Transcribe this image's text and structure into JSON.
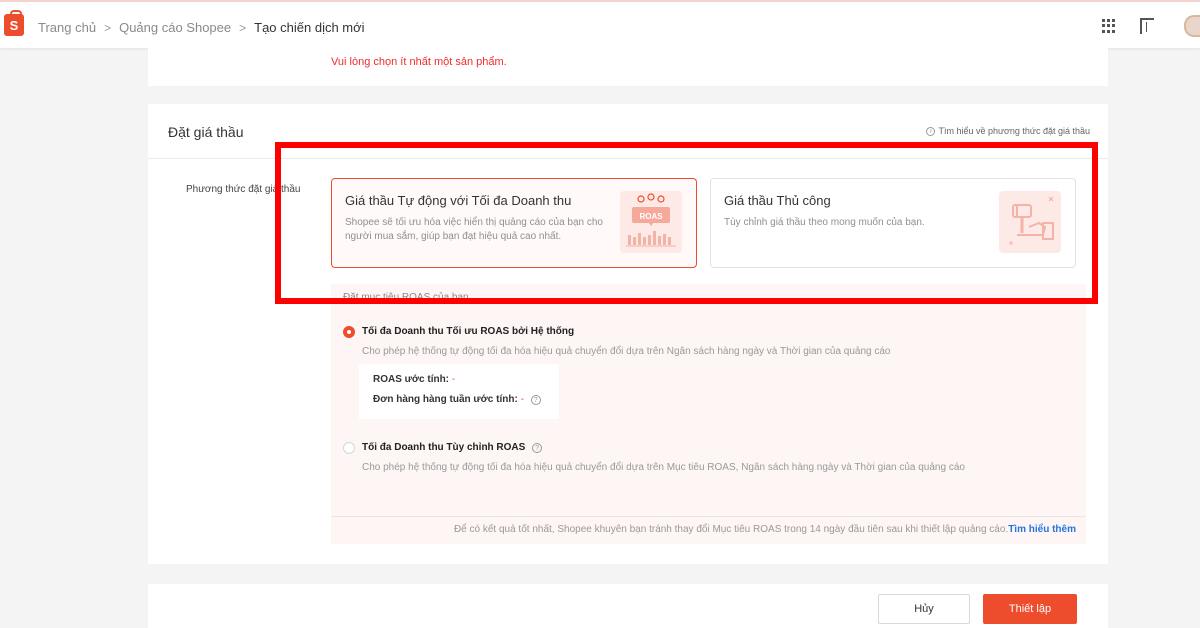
{
  "header": {
    "logo_text": "S",
    "breadcrumb": [
      "Trang chủ",
      "Quảng cáo Shopee",
      "Tạo chiến dịch mới"
    ],
    "separator": ">"
  },
  "product_section": {
    "error": "Vui lòng chọn ít nhất một sản phẩm."
  },
  "bidding": {
    "title": "Đặt giá thầu",
    "learn_more": "Tìm hiểu về phương thức đặt giá thầu",
    "method_label": "Phương thức đặt giá thầu",
    "options": [
      {
        "title": "Giá thầu Tự động với Tối đa Doanh thu",
        "description": "Shopee sẽ tối ưu hóa việc hiển thị quảng cáo của bạn cho người mua sắm, giúp bạn đạt hiệu quả cao nhất.",
        "illustration_text": "ROAS",
        "selected": true
      },
      {
        "title": "Giá thầu Thủ công",
        "description": "Tùy chỉnh giá thầu theo mong muốn của bạn.",
        "selected": false
      }
    ],
    "roas": {
      "heading": "Đặt mục tiêu ROAS của bạn",
      "choices": [
        {
          "title": "Tối đa Doanh thu Tối ưu ROAS bởi Hệ thống",
          "description": "Cho phép hệ thống tự động tối đa hóa hiệu quả chuyển đổi dựa trên Ngân sách hàng ngày và Thời gian của quảng cáo",
          "selected": true
        },
        {
          "title": "Tối đa Doanh thu Tùy chỉnh ROAS",
          "description": "Cho phép hệ thống tự động tối đa hóa hiệu quả chuyển đổi dựa trên Mục tiêu ROAS, Ngân sách hàng ngày và Thời gian của quảng cáo",
          "selected": false
        }
      ],
      "metrics": [
        {
          "label": "ROAS ước tính:",
          "value": "-"
        },
        {
          "label": "Đơn hàng hàng tuần ước tính:",
          "value": "-"
        }
      ],
      "tip": "Để có kết quả tốt nhất, Shopee khuyên bạn tránh thay đổi Mục tiêu ROAS trong 14 ngày đầu tiên sau khi thiết lập quảng cáo.",
      "tip_link": "Tìm hiểu thêm"
    }
  },
  "actions": {
    "cancel": "Hủy",
    "setup": "Thiết lập"
  },
  "colors": {
    "brand": "#ee4d2d",
    "highlight": "#ff0000",
    "link": "#2673dd"
  }
}
